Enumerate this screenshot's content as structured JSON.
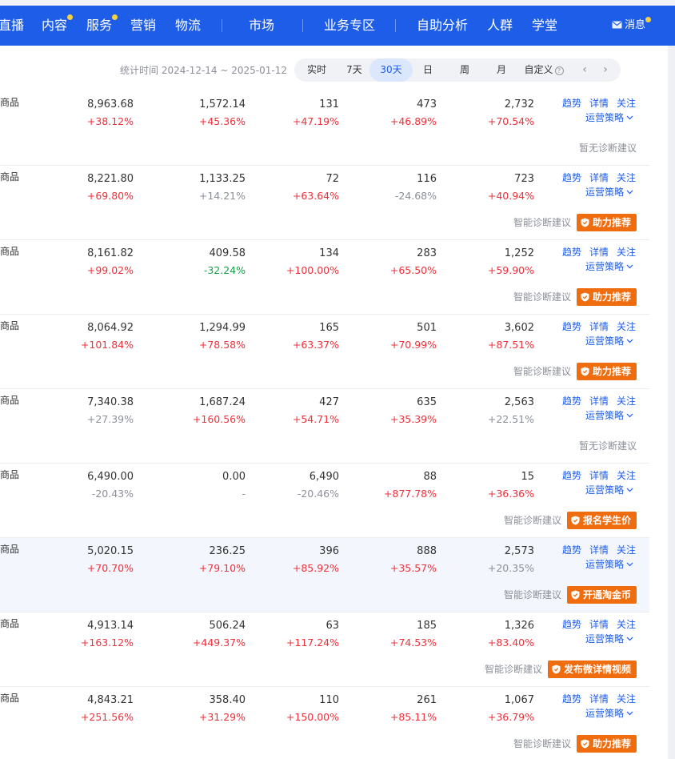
{
  "nav": {
    "items": [
      {
        "label": "直播",
        "dot": false
      },
      {
        "label": "内容",
        "dot": true
      },
      {
        "label": "服务",
        "dot": true
      },
      {
        "label": "营销",
        "dot": false
      },
      {
        "label": "物流",
        "dot": false
      },
      {
        "label": "市场",
        "dot": false
      },
      {
        "label": "业务专区",
        "dot": false
      },
      {
        "label": "自助分析",
        "dot": false
      },
      {
        "label": "人群",
        "dot": false
      },
      {
        "label": "学堂",
        "dot": false
      }
    ],
    "message": "消息",
    "message_icon": "mail-icon"
  },
  "filter": {
    "stat_label": "统计时间 2024-12-14 ~ 2025-01-12",
    "ranges": [
      "实时",
      "7天",
      "30天",
      "日",
      "周",
      "月",
      "自定义"
    ],
    "active_range": "30天",
    "help_icon": "question-icon",
    "prev_icon": "chevron-left-icon",
    "next_icon": "chevron-right-icon"
  },
  "colors": {
    "brand": "#1e5de8",
    "up": "#f0303a",
    "down": "#16a34a",
    "action_orange": "#ef6c0f"
  },
  "row_actions": {
    "trend": "趋势",
    "detail": "详情",
    "follow": "关注",
    "strategy": "运营策略"
  },
  "rows": [
    {
      "label": "主商品",
      "values": [
        "8,963.68",
        "1,572.14",
        "131",
        "473",
        "2,732"
      ],
      "changes": [
        "+38.12%",
        "+45.36%",
        "+47.19%",
        "+46.89%",
        "+70.54%"
      ],
      "diag_text": "暂无诊断建议",
      "action": "",
      "highlight": false
    },
    {
      "label": "主商品",
      "values": [
        "8,221.80",
        "1,133.25",
        "72",
        "116",
        "723"
      ],
      "changes": [
        "+69.80%",
        "+14.21%",
        "+63.64%",
        "-24.68%",
        "+40.94%"
      ],
      "diag_text": "智能诊断建议",
      "action": "助力推荐",
      "highlight": false
    },
    {
      "label": "主商品",
      "values": [
        "8,161.82",
        "409.58",
        "134",
        "283",
        "1,252"
      ],
      "changes": [
        "+99.02%",
        "-32.24%",
        "+100.00%",
        "+65.50%",
        "+59.90%"
      ],
      "diag_text": "智能诊断建议",
      "action": "助力推荐",
      "highlight": false
    },
    {
      "label": "主商品",
      "values": [
        "8,064.92",
        "1,294.99",
        "165",
        "501",
        "3,602"
      ],
      "changes": [
        "+101.84%",
        "+78.58%",
        "+63.37%",
        "+70.99%",
        "+87.51%"
      ],
      "diag_text": "智能诊断建议",
      "action": "助力推荐",
      "highlight": false
    },
    {
      "label": "主商品",
      "values": [
        "7,340.38",
        "1,687.24",
        "427",
        "635",
        "2,563"
      ],
      "changes": [
        "+27.39%",
        "+160.56%",
        "+54.71%",
        "+35.39%",
        "+22.51%"
      ],
      "diag_text": "暂无诊断建议",
      "action": "",
      "highlight": false
    },
    {
      "label": "主商品",
      "values": [
        "6,490.00",
        "0.00",
        "6,490",
        "88",
        "15"
      ],
      "changes": [
        "-20.43%",
        "-",
        "-20.46%",
        "+877.78%",
        "+36.36%"
      ],
      "diag_text": "智能诊断建议",
      "action": "报名学生价",
      "highlight": false
    },
    {
      "label": "主商品",
      "values": [
        "5,020.15",
        "236.25",
        "396",
        "888",
        "2,573"
      ],
      "changes": [
        "+70.70%",
        "+79.10%",
        "+85.92%",
        "+35.57%",
        "+20.35%"
      ],
      "diag_text": "智能诊断建议",
      "action": "开通淘金币",
      "highlight": true
    },
    {
      "label": "主商品",
      "values": [
        "4,913.14",
        "506.24",
        "63",
        "185",
        "1,326"
      ],
      "changes": [
        "+163.12%",
        "+449.37%",
        "+117.24%",
        "+74.53%",
        "+83.40%"
      ],
      "diag_text": "智能诊断建议",
      "action": "发布微详情视频",
      "highlight": false
    },
    {
      "label": "主商品",
      "values": [
        "4,843.21",
        "358.40",
        "110",
        "261",
        "1,067"
      ],
      "changes": [
        "+251.56%",
        "+31.29%",
        "+150.00%",
        "+85.11%",
        "+36.79%"
      ],
      "diag_text": "智能诊断建议",
      "action": "助力推荐",
      "highlight": false
    }
  ]
}
